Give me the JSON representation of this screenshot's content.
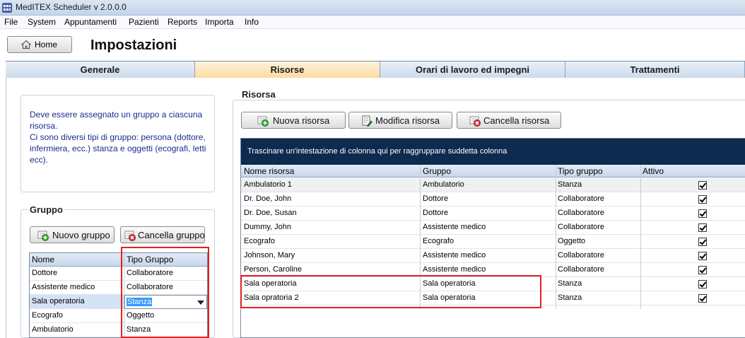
{
  "window": {
    "title": "MedITEX  Scheduler v 2.0.0.0"
  },
  "menu": [
    "File",
    "System",
    "Appuntamenti",
    "Pazienti",
    "Reports",
    "Importa",
    "Info"
  ],
  "home_button": "Home",
  "page_title": "Impostazioni",
  "tabs": [
    "Generale",
    "Risorse",
    "Orari di lavoro ed impegni",
    "Trattamenti"
  ],
  "active_tab": "Risorse",
  "info_text": "Deve essere assegnato un gruppo a ciascuna risorsa.\nCi sono diversi tipi di gruppo: persona (dottore, infermiera, ecc.) stanza e oggetti (ecografi, letti ecc).",
  "group": {
    "label": "Gruppo",
    "new_button": "Nuovo gruppo",
    "delete_button": "Cancella gruppo",
    "columns": [
      "Nome",
      "Tipo Gruppo"
    ],
    "rows": [
      [
        "Dottore",
        "Collaboratore"
      ],
      [
        "Assistente medico",
        "Collaboratore"
      ],
      [
        "Sala operatoria",
        "Stanza"
      ],
      [
        "Ecografo",
        "Oggetto"
      ],
      [
        "Ambulatorio",
        "Stanza"
      ]
    ],
    "selected_row": 2
  },
  "resource": {
    "label": "Risorsa",
    "new_button": "Nuova risorsa",
    "edit_button": "Modifica risorsa",
    "delete_button": "Cancella risorsa",
    "group_hint": "Trascinare un'intestazione di colonna qui per raggruppare suddetta colonna",
    "columns": [
      "Nome risorsa",
      "Gruppo",
      "Tipo gruppo",
      "Attivo"
    ],
    "rows": [
      [
        "Ambulatorio 1",
        "Ambulatorio",
        "Stanza",
        true
      ],
      [
        "Dr. Doe, John",
        "Dottore",
        "Collaboratore",
        true
      ],
      [
        "Dr. Doe, Susan",
        "Dottore",
        "Collaboratore",
        true
      ],
      [
        "Dummy, John",
        "Assistente medico",
        "Collaboratore",
        true
      ],
      [
        "Ecografo",
        "Ecografo",
        "Oggetto",
        true
      ],
      [
        "Johnson, Mary",
        "Assistente medico",
        "Collaboratore",
        true
      ],
      [
        "Person, Caroline",
        "Assistente medico",
        "Collaboratore",
        true
      ],
      [
        "Sala operatoria",
        "Sala operatoria",
        "Stanza",
        true
      ],
      [
        "Sala opratoria 2",
        "Sala operatoria",
        "Stanza",
        true
      ]
    ]
  },
  "colors": {
    "highlight": "#e32020",
    "hint_bar": "#0d2a4f",
    "info_text": "#1a2b8e"
  }
}
